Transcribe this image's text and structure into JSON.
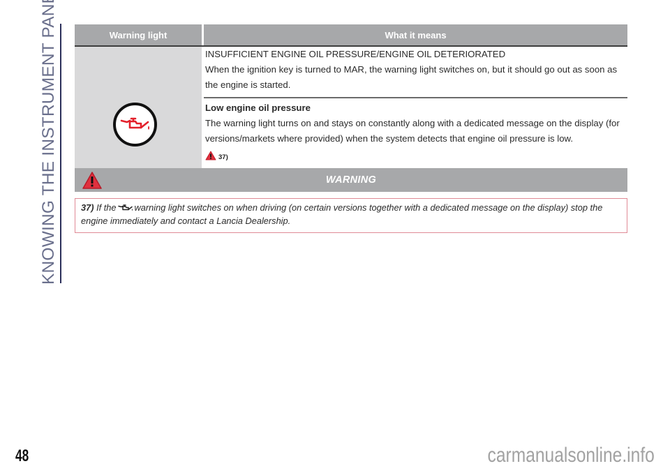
{
  "section_title": "KNOWING THE INSTRUMENT PANEL",
  "table": {
    "headers": [
      "Warning light",
      "What it means"
    ],
    "row": {
      "icon": "engine-oil-pressure-icon",
      "icon_color": "#e3202b",
      "blocks": [
        {
          "heading": "INSUFFICIENT ENGINE OIL PRESSURE/ENGINE OIL DETERIORATED",
          "text": "When the ignition key is turned to MAR, the warning light switches on, but it should go out as soon as the engine is started."
        },
        {
          "subheading": "Low engine oil pressure",
          "text": "The warning light turns on and stays on constantly along with a dedicated message on the display (for versions/markets where provided) when the system detects that engine oil pressure is low.",
          "reference": "37)"
        }
      ]
    }
  },
  "warning": {
    "title": "WARNING",
    "number": "37)",
    "text_before_icon": "If the",
    "text_after_icon": "warning light switches on when driving (on certain versions together with a dedicated message on the display) stop the engine immediately and contact a Lancia Dealership.",
    "accent_color": "#e08a96"
  },
  "footer": {
    "page_number": "48",
    "watermark": "carmanualsonline.info"
  }
}
